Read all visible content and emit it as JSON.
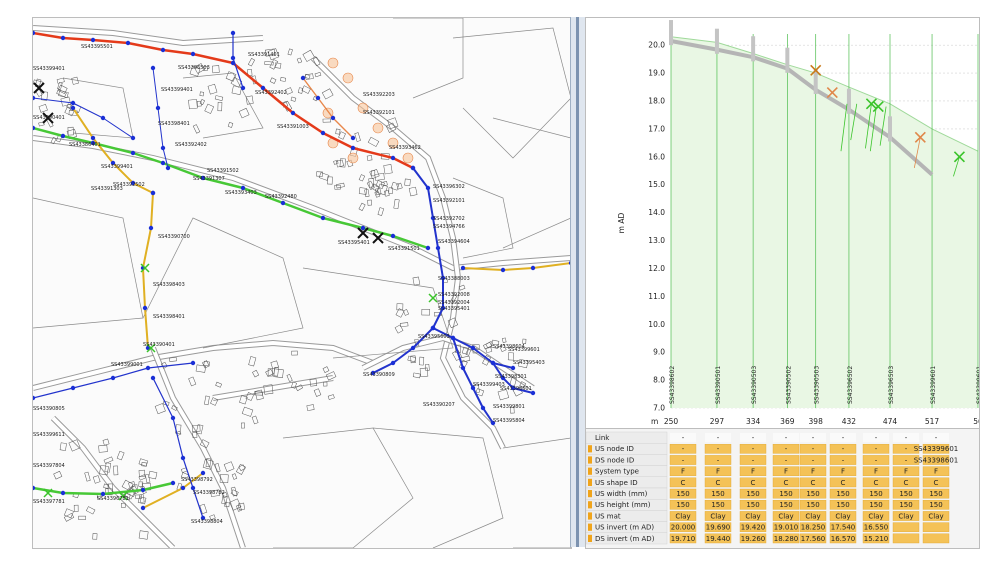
{
  "map": {
    "node_labels": [
      {
        "text": "SS43395501",
        "x": 48,
        "y": 30
      },
      {
        "text": "SS43396503",
        "x": 145,
        "y": 51
      },
      {
        "text": "SS43391401",
        "x": 215,
        "y": 38
      },
      {
        "text": "SS43392402",
        "x": 222,
        "y": 76
      },
      {
        "text": "SS43392203",
        "x": 330,
        "y": 78
      },
      {
        "text": "SS43392101",
        "x": 330,
        "y": 96
      },
      {
        "text": "SS43391003",
        "x": 244,
        "y": 110
      },
      {
        "text": "SS43393462",
        "x": 356,
        "y": 131
      },
      {
        "text": "SS43399401",
        "x": 128,
        "y": 73
      },
      {
        "text": "SS43398401",
        "x": 125,
        "y": 107
      },
      {
        "text": "SS43386401",
        "x": 36,
        "y": 128
      },
      {
        "text": "SS43392402",
        "x": 142,
        "y": 128
      },
      {
        "text": "SS43399401",
        "x": 68,
        "y": 150
      },
      {
        "text": "SS43391502",
        "x": 174,
        "y": 154
      },
      {
        "text": "SS43391303",
        "x": 58,
        "y": 172
      },
      {
        "text": "SS43391307",
        "x": 160,
        "y": 162
      },
      {
        "text": "SS43393403",
        "x": 192,
        "y": 176
      },
      {
        "text": "SS43392480",
        "x": 232,
        "y": 180
      },
      {
        "text": "SS43392502",
        "x": 80,
        "y": 168
      },
      {
        "text": "SS43390700",
        "x": 125,
        "y": 220
      },
      {
        "text": "SS43395401",
        "x": 305,
        "y": 226
      },
      {
        "text": "SS43391501",
        "x": 355,
        "y": 232
      },
      {
        "text": "SS43396302",
        "x": 400,
        "y": 170
      },
      {
        "text": "SS43392101",
        "x": 400,
        "y": 184
      },
      {
        "text": "SS43392702",
        "x": 400,
        "y": 202
      },
      {
        "text": "SS43394766",
        "x": 400,
        "y": 210
      },
      {
        "text": "SS43394604",
        "x": 405,
        "y": 225
      },
      {
        "text": "SS43388003",
        "x": 405,
        "y": 262
      },
      {
        "text": "SS43392008",
        "x": 405,
        "y": 278
      },
      {
        "text": "SS43392004",
        "x": 405,
        "y": 286
      },
      {
        "text": "SS43395401",
        "x": 405,
        "y": 292
      },
      {
        "text": "SS43398403",
        "x": 120,
        "y": 268
      },
      {
        "text": "SS43398401",
        "x": 120,
        "y": 300
      },
      {
        "text": "SS43390401",
        "x": 110,
        "y": 328
      },
      {
        "text": "SS43395603",
        "x": 385,
        "y": 320
      },
      {
        "text": "SS43398604",
        "x": 460,
        "y": 330
      },
      {
        "text": "SS43399601",
        "x": 475,
        "y": 333
      },
      {
        "text": "SS43395403",
        "x": 480,
        "y": 346
      },
      {
        "text": "SS43398301",
        "x": 462,
        "y": 360
      },
      {
        "text": "SS43398601",
        "x": 467,
        "y": 372
      },
      {
        "text": "SS43399403",
        "x": 440,
        "y": 368
      },
      {
        "text": "SS43399801",
        "x": 460,
        "y": 390
      },
      {
        "text": "SS43395804",
        "x": 460,
        "y": 404
      },
      {
        "text": "SS43390207",
        "x": 390,
        "y": 388
      },
      {
        "text": "SS43390809",
        "x": 330,
        "y": 358
      },
      {
        "text": "SS43399001",
        "x": 78,
        "y": 348
      },
      {
        "text": "SS43390805",
        "x": 0,
        "y": 392
      },
      {
        "text": "SS43399611",
        "x": 0,
        "y": 418
      },
      {
        "text": "SS43397804",
        "x": 0,
        "y": 449
      },
      {
        "text": "SS43398792",
        "x": 148,
        "y": 463
      },
      {
        "text": "SS43398782",
        "x": 160,
        "y": 476
      },
      {
        "text": "SS43398804",
        "x": 158,
        "y": 505
      },
      {
        "text": "SS43396781",
        "x": 64,
        "y": 482
      },
      {
        "text": "SS43397781",
        "x": 0,
        "y": 485
      },
      {
        "text": "SS43399401",
        "x": 0,
        "y": 52
      },
      {
        "text": "SS43390401",
        "x": 0,
        "y": 101
      }
    ]
  },
  "profile": {
    "y_ticks": [
      "20.0",
      "19.0",
      "18.0",
      "17.0",
      "16.0",
      "15.0",
      "14.0",
      "13.0",
      "12.0",
      "11.0",
      "10.0",
      "9.0",
      "8.0",
      "7.0"
    ],
    "y_axis_label": "m AD",
    "x_axis_unit": "m",
    "x_ticks": [
      "250",
      "297",
      "334",
      "369",
      "398",
      "432",
      "474",
      "517",
      "56"
    ],
    "node_labels": [
      "SS43398602",
      "SS43390501",
      "SS43390503",
      "SS43390502",
      "SS43390503",
      "SS43396502",
      "SS43396503",
      "SS43399601",
      "SS43399601"
    ]
  },
  "table": {
    "row_labels": [
      "Link",
      "US node ID",
      "DS node ID",
      "System type",
      "US shape ID",
      "US width (mm)",
      "US height (mm)",
      "US mat",
      "US invert (m AD)",
      "DS invert (m AD)"
    ],
    "link_values": [
      "-",
      "-",
      "-",
      "-",
      "-",
      "-",
      "-",
      "-",
      "-"
    ],
    "system_type": [
      "F",
      "F",
      "F",
      "F",
      "F",
      "F",
      "F",
      "F",
      "F"
    ],
    "shape_id": [
      "C",
      "C",
      "C",
      "C",
      "C",
      "C",
      "C",
      "C",
      "C"
    ],
    "widths": [
      "150",
      "150",
      "150",
      "150",
      "150",
      "150",
      "150",
      "150",
      "150"
    ],
    "heights": [
      "150",
      "150",
      "150",
      "150",
      "150",
      "150",
      "150",
      "150",
      "150"
    ],
    "mats": [
      "Clay",
      "Clay",
      "Clay",
      "Clay",
      "Clay",
      "Clay",
      "Clay",
      "Clay",
      "Clay"
    ],
    "us_inverts": [
      "20.000",
      "19.690",
      "19.420",
      "19.010",
      "18.250",
      "17.540",
      "16.550"
    ],
    "ds_inverts": [
      "19.710",
      "19.440",
      "19.260",
      "18.280",
      "17.560",
      "16.570",
      "15.210"
    ],
    "last_us_node": "SS43399601",
    "last_ds_node": "SS43398601"
  }
}
